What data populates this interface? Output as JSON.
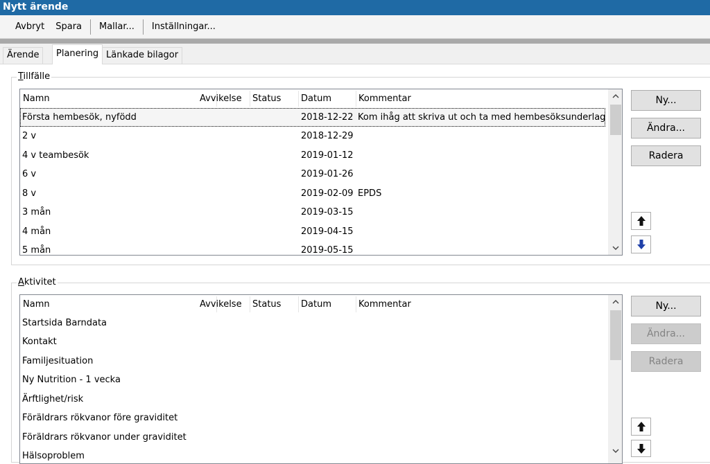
{
  "window": {
    "title": "Nytt ärende"
  },
  "toolbar": {
    "cancel": "Avbryt",
    "save": "Spara",
    "templates": "Mallar...",
    "settings": "Inställningar..."
  },
  "tabs": [
    {
      "label": "Ärende",
      "active": false
    },
    {
      "label": "Planering",
      "active": true
    },
    {
      "label": "Länkade bilagor",
      "active": false
    }
  ],
  "occasions": {
    "label_mnemonic": "T",
    "label_rest": "illfälle",
    "columns": [
      "Namn",
      "Avvikelse",
      "Status",
      "Datum",
      "Kommentar"
    ],
    "rows": [
      {
        "name": "Första hembesök, nyfödd",
        "deviation": "",
        "status": "",
        "date": "2018-12-22",
        "comment": "Kom ihåg att skriva ut och ta med hembesöksunderlag",
        "selected": true
      },
      {
        "name": "2 v",
        "deviation": "",
        "status": "",
        "date": "2018-12-29",
        "comment": ""
      },
      {
        "name": "4 v teambesök",
        "deviation": "",
        "status": "",
        "date": "2019-01-12",
        "comment": ""
      },
      {
        "name": "6 v",
        "deviation": "",
        "status": "",
        "date": "2019-01-26",
        "comment": ""
      },
      {
        "name": "8 v",
        "deviation": "",
        "status": "",
        "date": "2019-02-09",
        "comment": "EPDS"
      },
      {
        "name": "3 mån",
        "deviation": "",
        "status": "",
        "date": "2019-03-15",
        "comment": ""
      },
      {
        "name": "4 mån",
        "deviation": "",
        "status": "",
        "date": "2019-04-15",
        "comment": ""
      },
      {
        "name": "5 mån",
        "deviation": "",
        "status": "",
        "date": "2019-05-15",
        "comment": ""
      }
    ],
    "buttons": {
      "new": "Ny...",
      "edit": "Ändra...",
      "delete": "Radera"
    }
  },
  "activities": {
    "label_mnemonic": "A",
    "label_rest": "ktivitet",
    "columns": [
      "Namn",
      "Avvikelse",
      "Status",
      "Datum",
      "Kommentar"
    ],
    "rows": [
      {
        "name": "Startsida Barndata"
      },
      {
        "name": "Kontakt"
      },
      {
        "name": "Familjesituation"
      },
      {
        "name": "Ny Nutrition - 1 vecka"
      },
      {
        "name": "Ärftlighet/risk"
      },
      {
        "name": "Föräldrars rökvanor före graviditet"
      },
      {
        "name": "Föräldrars rökvanor under graviditet"
      },
      {
        "name": "Hälsoproblem"
      }
    ],
    "buttons": {
      "new": "Ny...",
      "edit": "Ändra...",
      "delete": "Radera",
      "edit_enabled": false,
      "delete_enabled": false
    }
  }
}
